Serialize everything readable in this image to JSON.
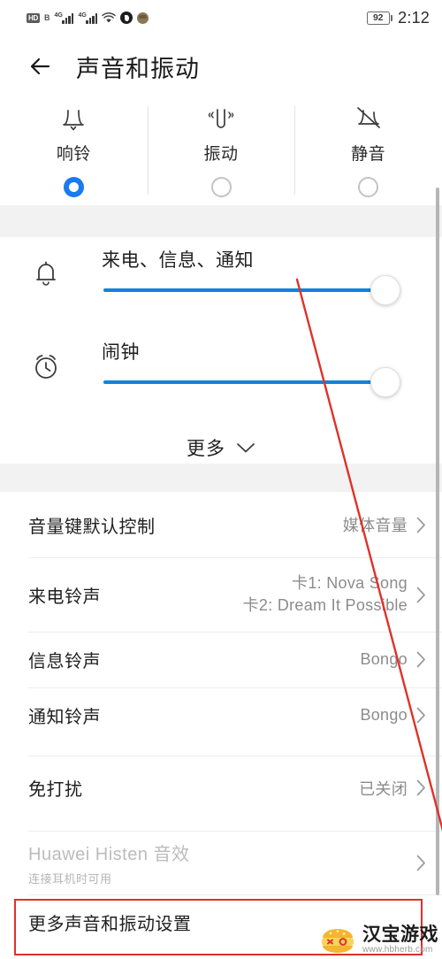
{
  "status_bar": {
    "hd_badge": "HD",
    "volte_badge": "B",
    "network_label_1": "4G",
    "network_label_2": "4G",
    "icons": [
      "hd-icon",
      "volte-icon",
      "signal-bars-sim1-icon",
      "signal-bars-sim2-icon",
      "wifi-icon",
      "data-saver-icon",
      "profile-icon"
    ],
    "battery_level": "92",
    "time": "2:12"
  },
  "header": {
    "back_icon": "back-arrow-icon",
    "title": "声音和振动"
  },
  "modes": [
    {
      "label": "响铃",
      "icon": "bell-icon",
      "selected": true
    },
    {
      "label": "振动",
      "icon": "vibrate-icon",
      "selected": false
    },
    {
      "label": "静音",
      "icon": "bell-muted-icon",
      "selected": false
    }
  ],
  "sliders": [
    {
      "label": "来电、信息、通知",
      "icon": "bell-icon",
      "value": 100
    },
    {
      "label": "闹钟",
      "icon": "alarm-clock-icon",
      "value": 100
    }
  ],
  "more_toggle": {
    "label": "更多",
    "icon": "chevron-down-icon"
  },
  "list": [
    {
      "title": "音量键默认控制",
      "value": "媒体音量",
      "subtitle": "",
      "disabled": false
    },
    {
      "title": "来电铃声",
      "value": "卡1: Nova Song",
      "value2": "卡2: Dream It Possible",
      "subtitle": "",
      "disabled": false
    },
    {
      "title": "信息铃声",
      "value": "Bongo",
      "subtitle": "",
      "disabled": false
    },
    {
      "title": "通知铃声",
      "value": "Bongo",
      "subtitle": "",
      "disabled": false
    },
    {
      "title": "免打扰",
      "value": "已关闭",
      "subtitle": "",
      "disabled": false
    },
    {
      "title": "Huawei Histen 音效",
      "value": "",
      "subtitle": "连接耳机时可用",
      "disabled": true
    },
    {
      "title": "更多声音和振动设置",
      "value": "",
      "subtitle": "",
      "disabled": false
    }
  ],
  "annotation": {
    "color": "#e0312a",
    "type": "arrow-and-highlight-box"
  },
  "watermark": {
    "name": "汉宝游戏",
    "url": "www.hbherb.com",
    "logo": "burger-logo-icon"
  }
}
